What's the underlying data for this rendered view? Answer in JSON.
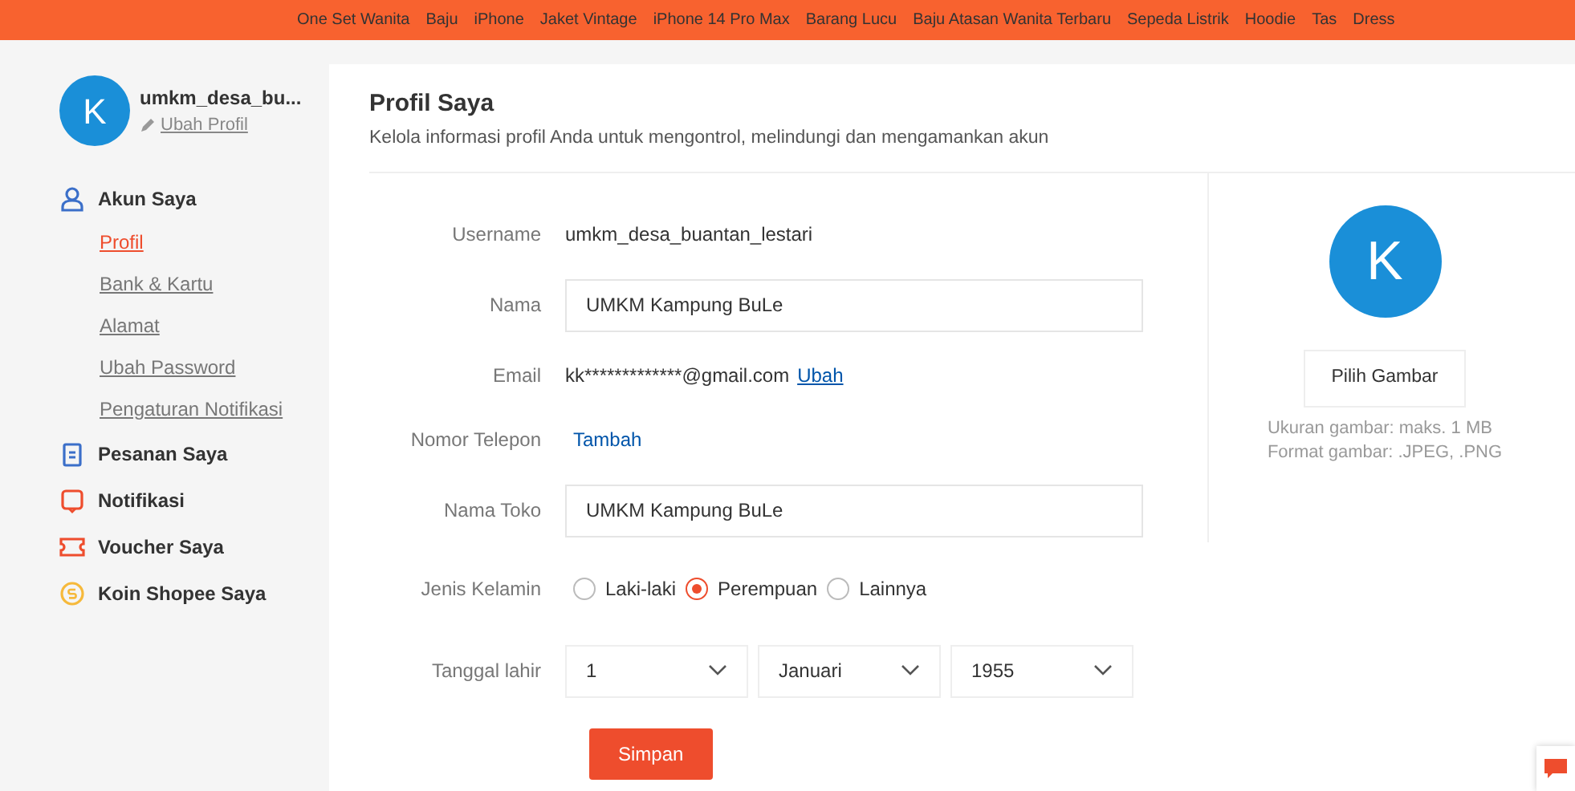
{
  "top_links": [
    "One Set Wanita",
    "Baju",
    "iPhone",
    "Jaket Vintage",
    "iPhone 14 Pro Max",
    "Barang Lucu",
    "Baju Atasan Wanita Terbaru",
    "Sepeda Listrik",
    "Hoodie",
    "Tas",
    "Dress"
  ],
  "user": {
    "initial": "K",
    "name": "umkm_desa_bu...",
    "edit": "Ubah Profil"
  },
  "menu": [
    {
      "label": "Akun Saya",
      "kind": "account",
      "color": "#3b6fc9",
      "children": [
        {
          "label": "Profil",
          "selected": true
        },
        {
          "label": "Bank & Kartu",
          "selected": false
        },
        {
          "label": "Alamat",
          "selected": false
        },
        {
          "label": "Ubah Password",
          "selected": false
        },
        {
          "label": "Pengaturan Notifikasi",
          "selected": false
        }
      ]
    },
    {
      "label": "Pesanan Saya",
      "kind": "orders",
      "color": "#3b6fc9"
    },
    {
      "label": "Notifikasi",
      "kind": "bell",
      "color": "#ee4d2d"
    },
    {
      "label": "Voucher Saya",
      "kind": "voucher",
      "color": "#ee4d2d"
    },
    {
      "label": "Koin Shopee Saya",
      "kind": "coin",
      "color": "#f6b93b"
    }
  ],
  "title": "Profil Saya",
  "subtitle": "Kelola informasi profil Anda untuk mengontrol, melindungi dan mengamankan akun",
  "form": [
    {
      "kind": "text",
      "label": "Username",
      "value": "umkm_desa_buantan_lestari"
    },
    {
      "kind": "input",
      "label": "Nama",
      "value": "UMKM Kampung BuLe"
    },
    {
      "kind": "text",
      "label": "Email",
      "value": "kk*************@gmail.com",
      "link": "Ubah"
    },
    {
      "kind": "link",
      "label": "Nomor Telepon",
      "link": "Tambah"
    },
    {
      "kind": "input",
      "label": "Nama Toko",
      "value": "UMKM Kampung BuLe"
    },
    {
      "kind": "radio",
      "label": "Jenis Kelamin",
      "options": [
        {
          "label": "Laki-laki",
          "selected": false
        },
        {
          "label": "Perempuan",
          "selected": true
        },
        {
          "label": "Lainnya",
          "selected": false
        }
      ]
    },
    {
      "kind": "selects",
      "label": "Tanggal lahir",
      "options": [
        "1",
        "Januari",
        "1955"
      ]
    }
  ],
  "save": "Simpan",
  "avatar": {
    "initial": "K",
    "button": "Pilih Gambar",
    "notes": [
      "Ukuran gambar: maks. 1 MB",
      "Format gambar: .JPEG, .PNG"
    ]
  }
}
